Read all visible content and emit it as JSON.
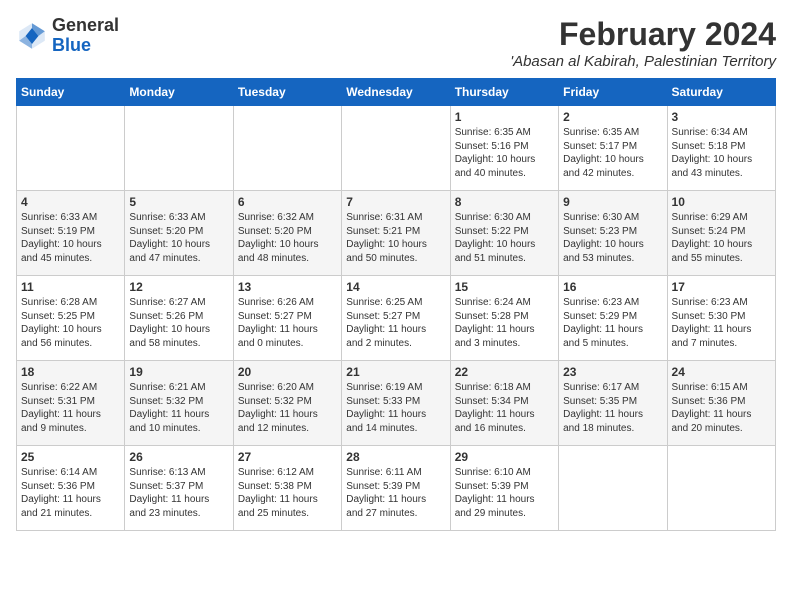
{
  "logo": {
    "line1": "General",
    "line2": "Blue"
  },
  "title": "February 2024",
  "location": "'Abasan al Kabirah, Palestinian Territory",
  "headers": [
    "Sunday",
    "Monday",
    "Tuesday",
    "Wednesday",
    "Thursday",
    "Friday",
    "Saturday"
  ],
  "weeks": [
    [
      {
        "day": "",
        "info": ""
      },
      {
        "day": "",
        "info": ""
      },
      {
        "day": "",
        "info": ""
      },
      {
        "day": "",
        "info": ""
      },
      {
        "day": "1",
        "info": "Sunrise: 6:35 AM\nSunset: 5:16 PM\nDaylight: 10 hours\nand 40 minutes."
      },
      {
        "day": "2",
        "info": "Sunrise: 6:35 AM\nSunset: 5:17 PM\nDaylight: 10 hours\nand 42 minutes."
      },
      {
        "day": "3",
        "info": "Sunrise: 6:34 AM\nSunset: 5:18 PM\nDaylight: 10 hours\nand 43 minutes."
      }
    ],
    [
      {
        "day": "4",
        "info": "Sunrise: 6:33 AM\nSunset: 5:19 PM\nDaylight: 10 hours\nand 45 minutes."
      },
      {
        "day": "5",
        "info": "Sunrise: 6:33 AM\nSunset: 5:20 PM\nDaylight: 10 hours\nand 47 minutes."
      },
      {
        "day": "6",
        "info": "Sunrise: 6:32 AM\nSunset: 5:20 PM\nDaylight: 10 hours\nand 48 minutes."
      },
      {
        "day": "7",
        "info": "Sunrise: 6:31 AM\nSunset: 5:21 PM\nDaylight: 10 hours\nand 50 minutes."
      },
      {
        "day": "8",
        "info": "Sunrise: 6:30 AM\nSunset: 5:22 PM\nDaylight: 10 hours\nand 51 minutes."
      },
      {
        "day": "9",
        "info": "Sunrise: 6:30 AM\nSunset: 5:23 PM\nDaylight: 10 hours\nand 53 minutes."
      },
      {
        "day": "10",
        "info": "Sunrise: 6:29 AM\nSunset: 5:24 PM\nDaylight: 10 hours\nand 55 minutes."
      }
    ],
    [
      {
        "day": "11",
        "info": "Sunrise: 6:28 AM\nSunset: 5:25 PM\nDaylight: 10 hours\nand 56 minutes."
      },
      {
        "day": "12",
        "info": "Sunrise: 6:27 AM\nSunset: 5:26 PM\nDaylight: 10 hours\nand 58 minutes."
      },
      {
        "day": "13",
        "info": "Sunrise: 6:26 AM\nSunset: 5:27 PM\nDaylight: 11 hours\nand 0 minutes."
      },
      {
        "day": "14",
        "info": "Sunrise: 6:25 AM\nSunset: 5:27 PM\nDaylight: 11 hours\nand 2 minutes."
      },
      {
        "day": "15",
        "info": "Sunrise: 6:24 AM\nSunset: 5:28 PM\nDaylight: 11 hours\nand 3 minutes."
      },
      {
        "day": "16",
        "info": "Sunrise: 6:23 AM\nSunset: 5:29 PM\nDaylight: 11 hours\nand 5 minutes."
      },
      {
        "day": "17",
        "info": "Sunrise: 6:23 AM\nSunset: 5:30 PM\nDaylight: 11 hours\nand 7 minutes."
      }
    ],
    [
      {
        "day": "18",
        "info": "Sunrise: 6:22 AM\nSunset: 5:31 PM\nDaylight: 11 hours\nand 9 minutes."
      },
      {
        "day": "19",
        "info": "Sunrise: 6:21 AM\nSunset: 5:32 PM\nDaylight: 11 hours\nand 10 minutes."
      },
      {
        "day": "20",
        "info": "Sunrise: 6:20 AM\nSunset: 5:32 PM\nDaylight: 11 hours\nand 12 minutes."
      },
      {
        "day": "21",
        "info": "Sunrise: 6:19 AM\nSunset: 5:33 PM\nDaylight: 11 hours\nand 14 minutes."
      },
      {
        "day": "22",
        "info": "Sunrise: 6:18 AM\nSunset: 5:34 PM\nDaylight: 11 hours\nand 16 minutes."
      },
      {
        "day": "23",
        "info": "Sunrise: 6:17 AM\nSunset: 5:35 PM\nDaylight: 11 hours\nand 18 minutes."
      },
      {
        "day": "24",
        "info": "Sunrise: 6:15 AM\nSunset: 5:36 PM\nDaylight: 11 hours\nand 20 minutes."
      }
    ],
    [
      {
        "day": "25",
        "info": "Sunrise: 6:14 AM\nSunset: 5:36 PM\nDaylight: 11 hours\nand 21 minutes."
      },
      {
        "day": "26",
        "info": "Sunrise: 6:13 AM\nSunset: 5:37 PM\nDaylight: 11 hours\nand 23 minutes."
      },
      {
        "day": "27",
        "info": "Sunrise: 6:12 AM\nSunset: 5:38 PM\nDaylight: 11 hours\nand 25 minutes."
      },
      {
        "day": "28",
        "info": "Sunrise: 6:11 AM\nSunset: 5:39 PM\nDaylight: 11 hours\nand 27 minutes."
      },
      {
        "day": "29",
        "info": "Sunrise: 6:10 AM\nSunset: 5:39 PM\nDaylight: 11 hours\nand 29 minutes."
      },
      {
        "day": "",
        "info": ""
      },
      {
        "day": "",
        "info": ""
      }
    ]
  ]
}
